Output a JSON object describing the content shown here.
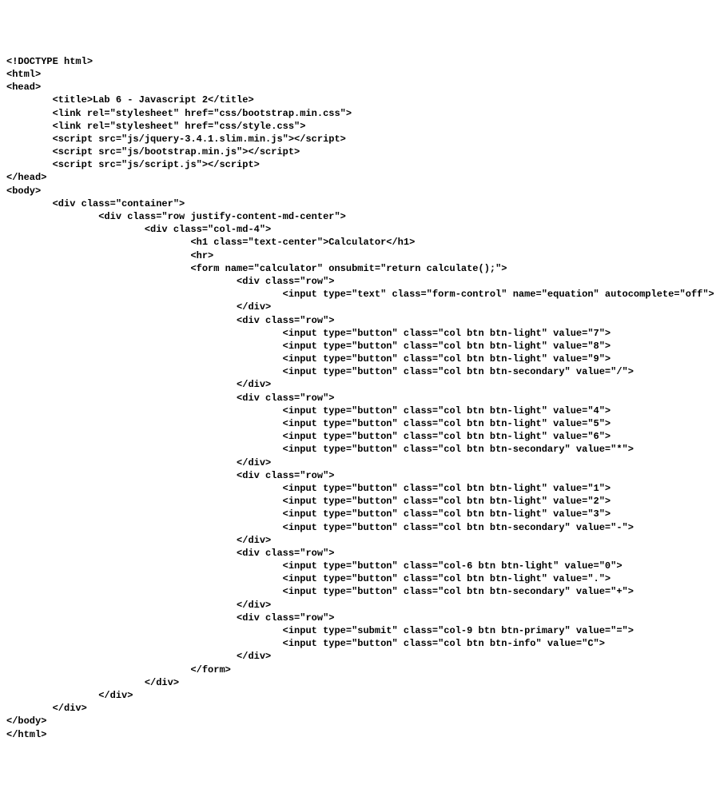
{
  "lines": [
    "<!DOCTYPE html>",
    "<html>",
    "<head>",
    "        <title>Lab 6 - Javascript 2</title>",
    "        <link rel=\"stylesheet\" href=\"css/bootstrap.min.css\">",
    "        <link rel=\"stylesheet\" href=\"css/style.css\">",
    "        <script src=\"js/jquery-3.4.1.slim.min.js\"></script>",
    "        <script src=\"js/bootstrap.min.js\"></script>",
    "        <script src=\"js/script.js\"></script>",
    "</head>",
    "<body>",
    "        <div class=\"container\">",
    "                <div class=\"row justify-content-md-center\">",
    "                        <div class=\"col-md-4\">",
    "                                <h1 class=\"text-center\">Calculator</h1>",
    "                                <hr>",
    "                                <form name=\"calculator\" onsubmit=\"return calculate();\">",
    "                                        <div class=\"row\">",
    "                                                <input type=\"text\" class=\"form-control\" name=\"equation\" autocomplete=\"off\">",
    "                                        </div>",
    "                                        <div class=\"row\">",
    "                                                <input type=\"button\" class=\"col btn btn-light\" value=\"7\">",
    "                                                <input type=\"button\" class=\"col btn btn-light\" value=\"8\">",
    "                                                <input type=\"button\" class=\"col btn btn-light\" value=\"9\">",
    "                                                <input type=\"button\" class=\"col btn btn-secondary\" value=\"/\">",
    "                                        </div>",
    "                                        <div class=\"row\">",
    "                                                <input type=\"button\" class=\"col btn btn-light\" value=\"4\">",
    "                                                <input type=\"button\" class=\"col btn btn-light\" value=\"5\">",
    "                                                <input type=\"button\" class=\"col btn btn-light\" value=\"6\">",
    "                                                <input type=\"button\" class=\"col btn btn-secondary\" value=\"*\">",
    "                                        </div>",
    "                                        <div class=\"row\">",
    "                                                <input type=\"button\" class=\"col btn btn-light\" value=\"1\">",
    "                                                <input type=\"button\" class=\"col btn btn-light\" value=\"2\">",
    "                                                <input type=\"button\" class=\"col btn btn-light\" value=\"3\">",
    "                                                <input type=\"button\" class=\"col btn btn-secondary\" value=\"-\">",
    "                                        </div>",
    "                                        <div class=\"row\">",
    "                                                <input type=\"button\" class=\"col-6 btn btn-light\" value=\"0\">",
    "                                                <input type=\"button\" class=\"col btn btn-light\" value=\".\">",
    "                                                <input type=\"button\" class=\"col btn btn-secondary\" value=\"+\">",
    "                                        </div>",
    "                                        <div class=\"row\">",
    "                                                <input type=\"submit\" class=\"col-9 btn btn-primary\" value=\"=\">",
    "                                                <input type=\"button\" class=\"col btn btn-info\" value=\"C\">",
    "                                        </div>",
    "                                </form>",
    "                        </div>",
    "                </div>",
    "        </div>",
    "</body>",
    "</html>"
  ]
}
